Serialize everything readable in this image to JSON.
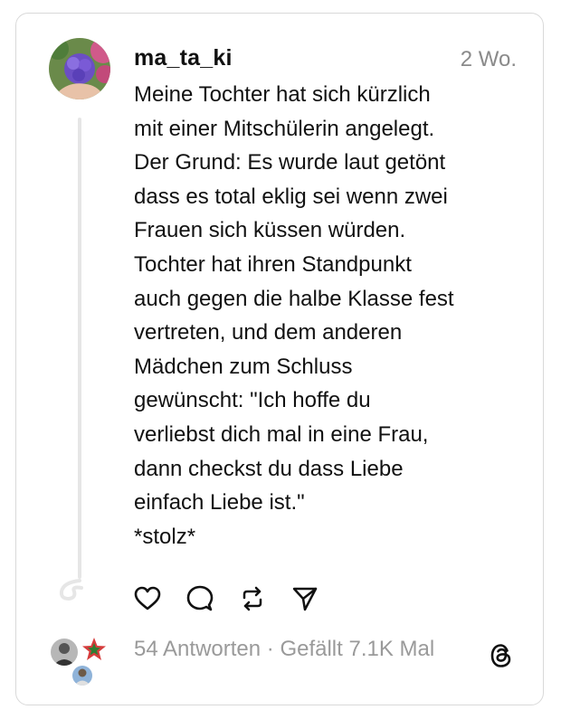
{
  "post": {
    "username": "ma_ta_ki",
    "time": "2 Wo.",
    "text": "Meine Tochter hat sich kürzlich\nmit einer Mitschülerin angelegt.\nDer Grund: Es wurde laut getönt\ndass es total eklig sei wenn zwei\nFrauen sich küssen würden.\nTochter hat ihren Standpunkt\nauch gegen die halbe Klasse fest\nvertreten, und dem anderen\nMädchen zum Schluss\ngewünscht: \"Ich hoffe du\nverliebst dich mal in eine Frau,\ndann checkst du dass Liebe\neinfach Liebe ist.\"\n*stolz*"
  },
  "actions": {
    "like_icon": "heart-icon",
    "reply_icon": "comment-icon",
    "repost_icon": "repost-icon",
    "share_icon": "send-icon"
  },
  "footer": {
    "replies": "54 Antworten",
    "separator": " · ",
    "likes": "Gefällt 7.1K Mal"
  },
  "colors": {
    "text": "#111111",
    "muted": "#8a8a8a",
    "border": "#d9d9d9",
    "thread_line": "#e6e6e6"
  }
}
